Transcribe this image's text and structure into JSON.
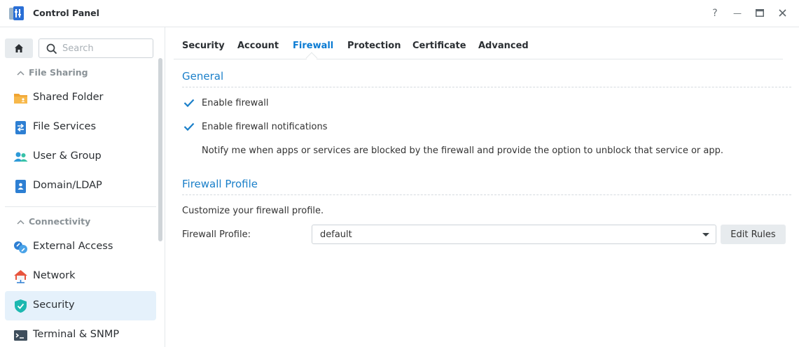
{
  "window": {
    "title": "Control Panel",
    "help_glyph": "?",
    "minimize_glyph": "—",
    "maximize_glyph": "▭",
    "close_glyph": "✕"
  },
  "sidebar": {
    "search_placeholder": "Search",
    "sections": [
      {
        "label": "File Sharing",
        "items": [
          {
            "label": "Shared Folder",
            "icon": "folder-icon"
          },
          {
            "label": "File Services",
            "icon": "file-services-icon"
          },
          {
            "label": "User & Group",
            "icon": "users-icon"
          },
          {
            "label": "Domain/LDAP",
            "icon": "domain-icon"
          }
        ]
      },
      {
        "label": "Connectivity",
        "items": [
          {
            "label": "External Access",
            "icon": "external-access-icon"
          },
          {
            "label": "Network",
            "icon": "network-icon"
          },
          {
            "label": "Security",
            "icon": "shield-icon",
            "active": true
          },
          {
            "label": "Terminal & SNMP",
            "icon": "terminal-icon"
          }
        ]
      }
    ]
  },
  "tabs": [
    {
      "label": "Security"
    },
    {
      "label": "Account"
    },
    {
      "label": "Firewall",
      "active": true
    },
    {
      "label": "Protection"
    },
    {
      "label": "Certificate"
    },
    {
      "label": "Advanced"
    }
  ],
  "general": {
    "title": "General",
    "enable_firewall": {
      "label": "Enable firewall",
      "checked": true
    },
    "enable_notifications": {
      "label": "Enable firewall notifications",
      "checked": true
    },
    "note": "Notify me when apps or services are blocked by the firewall and provide the option to unblock that service or app."
  },
  "profile": {
    "title": "Firewall Profile",
    "description": "Customize your firewall profile.",
    "field_label": "Firewall Profile:",
    "selected": "default",
    "edit_rules_label": "Edit Rules"
  },
  "colors": {
    "accent": "#0a7bd3",
    "active_bg": "#e5f1fb",
    "checkbox": "#1a7fc9"
  }
}
